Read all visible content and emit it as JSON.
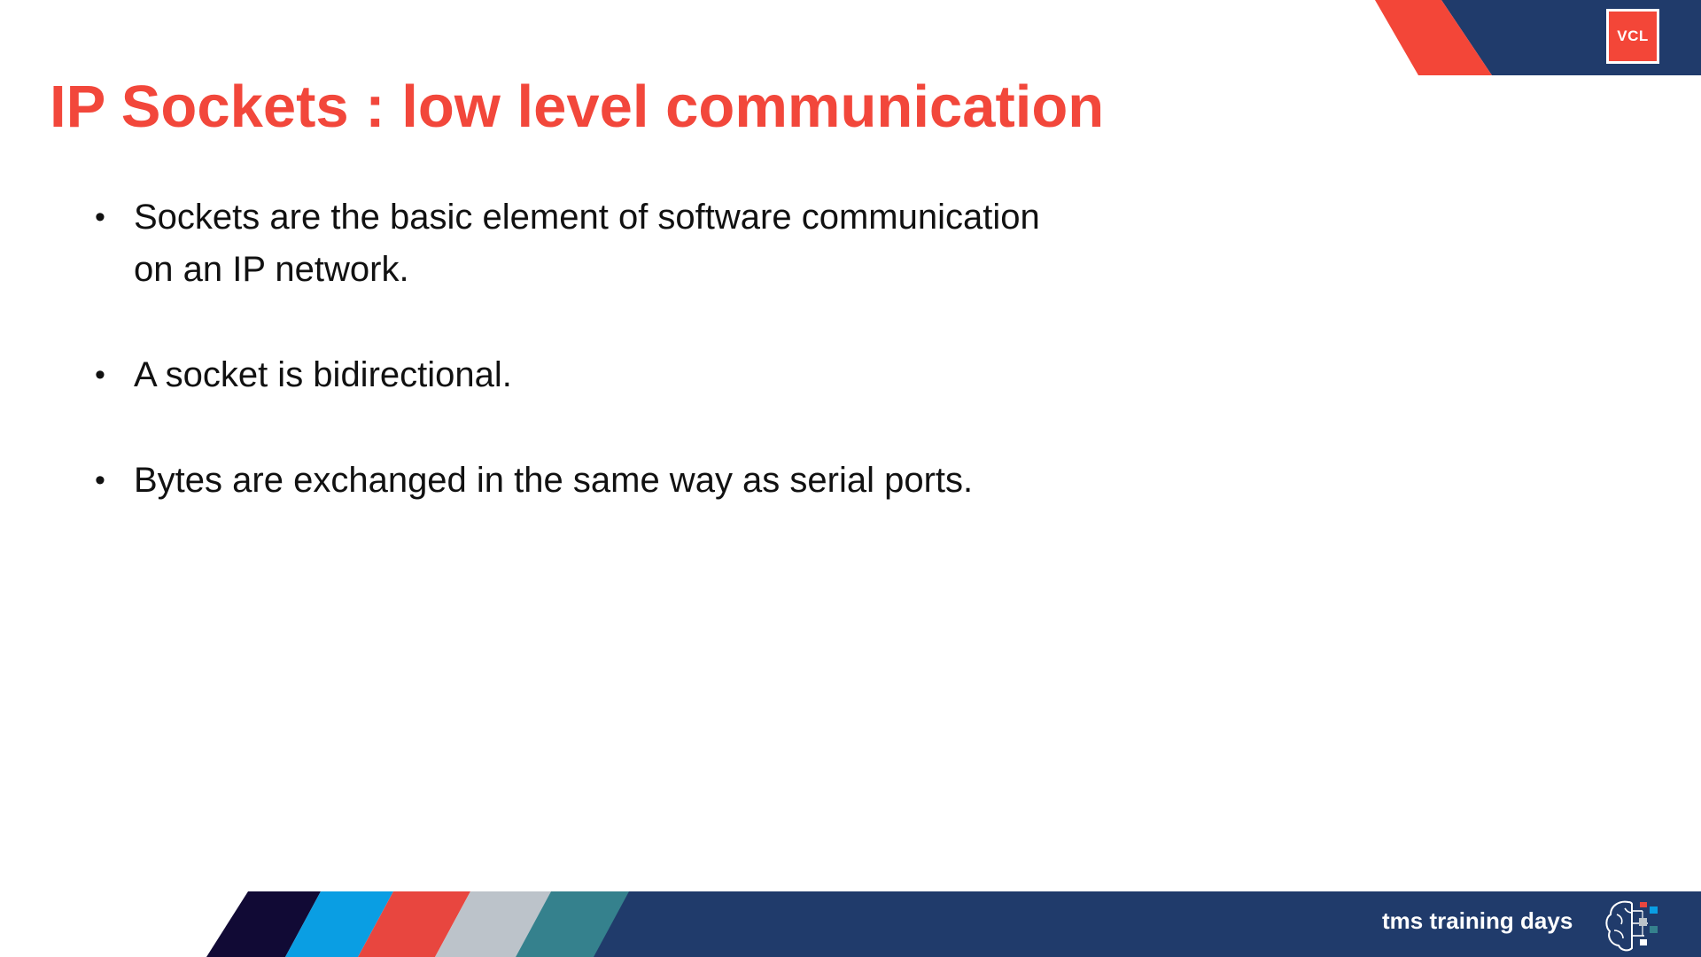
{
  "slide": {
    "title": "IP Sockets : low level communication",
    "badge_label": "VCL",
    "bullets": [
      {
        "line1": "Sockets are the basic element of software communication",
        "line2": "on an IP network."
      },
      {
        "line1": "A socket is bidirectional.",
        "line2": ""
      },
      {
        "line1": "Bytes are exchanged in the same way as serial ports.",
        "line2": ""
      }
    ],
    "bullet_symbol": "•",
    "footer_brand": "tms training days",
    "footer_logo_icon": "brain-network-icon"
  },
  "colors": {
    "title_red": "#f2473b",
    "accent_red": "#f34638",
    "navy": "#203b6b",
    "dark_navy": "#110a35",
    "blue": "#0a9ee3",
    "red_stripe": "#e8463f",
    "gray": "#bcc3ca",
    "teal": "#35818d",
    "text": "#111111"
  }
}
